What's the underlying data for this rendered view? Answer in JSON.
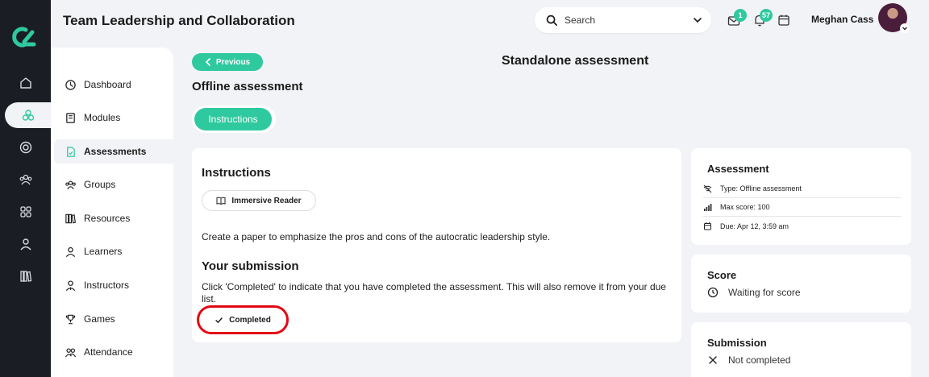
{
  "header": {
    "title": "Team Leadership and Collaboration",
    "search_label": "Search",
    "mail_badge": "1",
    "bell_badge": "57",
    "user_name": "Meghan Cass"
  },
  "sidebar": {
    "items": [
      {
        "label": "Dashboard",
        "icon": "dashboard-icon"
      },
      {
        "label": "Modules",
        "icon": "book-icon"
      },
      {
        "label": "Assessments",
        "icon": "file-check-icon"
      },
      {
        "label": "Groups",
        "icon": "users-icon"
      },
      {
        "label": "Resources",
        "icon": "library-icon"
      },
      {
        "label": "Learners",
        "icon": "user-icon"
      },
      {
        "label": "Instructors",
        "icon": "user-tie-icon"
      },
      {
        "label": "Games",
        "icon": "trophy-icon"
      },
      {
        "label": "Attendance",
        "icon": "users-icon"
      }
    ],
    "active": "Assessments"
  },
  "main": {
    "previous_label": "Previous",
    "standalone_title": "Standalone assessment",
    "assessment_title": "Offline assessment",
    "tab_label": "Instructions",
    "instructions_heading": "Instructions",
    "reader_label": "Immersive Reader",
    "instructions_text": "Create a paper to emphasize the pros and cons of the autocratic leadership style.",
    "submission_heading": "Your submission",
    "submission_text": "Click 'Completed' to indicate that you have completed the assessment. This will also remove it from your due list.",
    "completed_label": "Completed"
  },
  "assessment_card": {
    "heading": "Assessment",
    "type": "Type: Offline assessment",
    "max_score": "Max score: 100",
    "due": "Due: Apr 12, 3:59 am"
  },
  "score_card": {
    "heading": "Score",
    "status": "Waiting for score"
  },
  "submission_card": {
    "heading": "Submission",
    "status": "Not completed"
  },
  "colors": {
    "accent": "#2fc9a0",
    "rail": "#1a1d24",
    "background": "#f2f3f6",
    "highlight": "#e30914"
  }
}
